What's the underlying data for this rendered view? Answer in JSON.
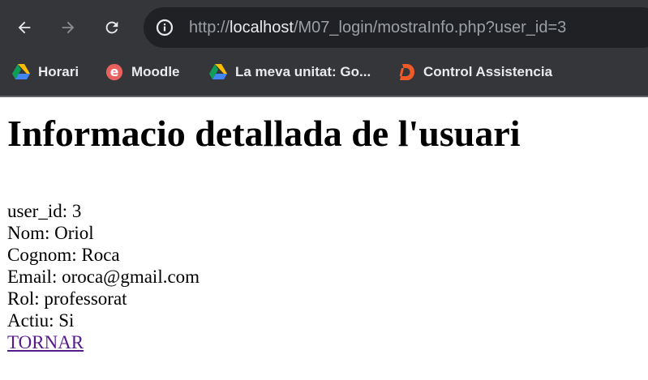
{
  "browser": {
    "url": {
      "scheme": "http://",
      "host": "localhost",
      "path": "/M07_login/mostraInfo.php?user_id=3"
    },
    "icons": {
      "back": "arrow-left-icon",
      "forward": "arrow-right-icon",
      "reload": "reload-icon",
      "site_info": "info-circle-icon"
    },
    "bookmarks": [
      {
        "label": "Horari",
        "icon": "google-drive-icon"
      },
      {
        "label": "Moodle",
        "icon": "moodle-icon"
      },
      {
        "label": "La meva unitat: Go...",
        "icon": "google-drive-icon"
      },
      {
        "label": "Control Assistencia",
        "icon": "d-logo-icon"
      }
    ],
    "colors": {
      "chrome_bg": "#35363a",
      "omnibox_bg": "#202124",
      "text": "#e8eaed",
      "muted": "#9aa0a6"
    }
  },
  "page": {
    "title": "Informacio detallada de l'usuari",
    "fields": [
      {
        "label": "user_id",
        "value": "3"
      },
      {
        "label": "Nom",
        "value": "Oriol"
      },
      {
        "label": "Cognom",
        "value": "Roca"
      },
      {
        "label": "Email",
        "value": "oroca@gmail.com"
      },
      {
        "label": "Rol",
        "value": "professorat"
      },
      {
        "label": "Actiu",
        "value": "Si"
      }
    ],
    "back_link": "TORNAR",
    "link_color": "#551a8b"
  }
}
